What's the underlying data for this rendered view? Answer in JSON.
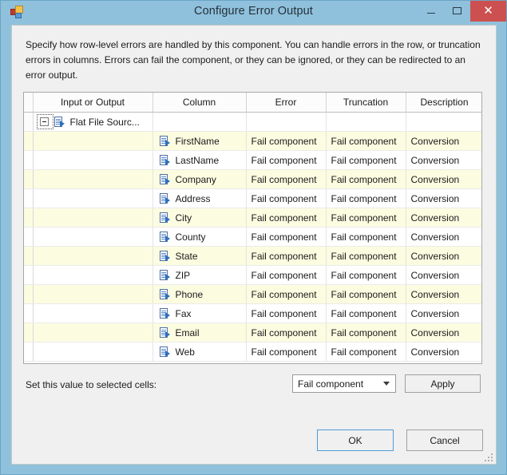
{
  "window": {
    "title": "Configure Error Output",
    "icon": "ssis-component-icon",
    "controls": {
      "minimize": "—",
      "maximize": "□",
      "close": "✕"
    }
  },
  "description": "Specify how row-level errors are handled by this component. You can handle errors in the row, or truncation errors in columns. Errors can fail the component, or they can be ignored, or they can be redirected to an error output.",
  "grid": {
    "headers": [
      "Input or Output",
      "Column",
      "Error",
      "Truncation",
      "Description"
    ],
    "parent_row": {
      "expander": "collapse",
      "label": "Flat File Sourc...",
      "icon": "flat-file-source-icon"
    },
    "rows": [
      {
        "input_or_output": "",
        "column": "FirstName",
        "error": "Fail component",
        "truncation": "Fail component",
        "description": "Conversion"
      },
      {
        "input_or_output": "",
        "column": "LastName",
        "error": "Fail component",
        "truncation": "Fail component",
        "description": "Conversion"
      },
      {
        "input_or_output": "",
        "column": "Company",
        "error": "Fail component",
        "truncation": "Fail component",
        "description": "Conversion"
      },
      {
        "input_or_output": "",
        "column": "Address",
        "error": "Fail component",
        "truncation": "Fail component",
        "description": "Conversion"
      },
      {
        "input_or_output": "",
        "column": "City",
        "error": "Fail component",
        "truncation": "Fail component",
        "description": "Conversion"
      },
      {
        "input_or_output": "",
        "column": "County",
        "error": "Fail component",
        "truncation": "Fail component",
        "description": "Conversion"
      },
      {
        "input_or_output": "",
        "column": "State",
        "error": "Fail component",
        "truncation": "Fail component",
        "description": "Conversion"
      },
      {
        "input_or_output": "",
        "column": "ZIP",
        "error": "Fail component",
        "truncation": "Fail component",
        "description": "Conversion"
      },
      {
        "input_or_output": "",
        "column": "Phone",
        "error": "Fail component",
        "truncation": "Fail component",
        "description": "Conversion"
      },
      {
        "input_or_output": "",
        "column": "Fax",
        "error": "Fail component",
        "truncation": "Fail component",
        "description": "Conversion"
      },
      {
        "input_or_output": "",
        "column": "Email",
        "error": "Fail component",
        "truncation": "Fail component",
        "description": "Conversion"
      },
      {
        "input_or_output": "",
        "column": "Web",
        "error": "Fail component",
        "truncation": "Fail component",
        "description": "Conversion"
      }
    ]
  },
  "setter": {
    "label": "Set this value to selected cells:",
    "selected_value": "Fail component",
    "apply_label": "Apply"
  },
  "footer": {
    "ok_label": "OK",
    "cancel_label": "Cancel"
  },
  "colors": {
    "titlebar": "#8fc1dc",
    "close_button": "#cd5050",
    "alt_row": "#fcfce1",
    "focus_border": "#4f9ad6"
  }
}
